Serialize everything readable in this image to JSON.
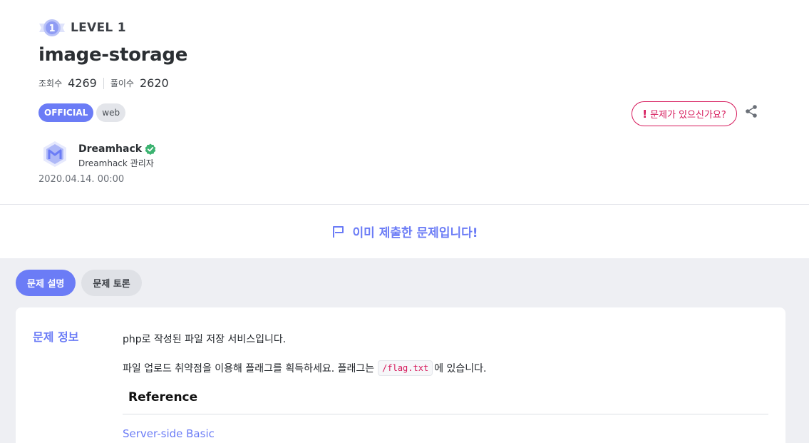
{
  "challenge": {
    "level_label": "LEVEL 1",
    "level_number": "1",
    "title": "image-storage",
    "views_label": "조회수",
    "views": "4269",
    "solves_label": "풀이수",
    "solves": "2620",
    "tags": [
      "OFFICIAL",
      "web"
    ],
    "report_button": "문제가 있으신가요?",
    "report_icon": "exclamation-icon",
    "share_icon": "share-icon"
  },
  "author": {
    "name": "Dreamhack",
    "role": "Dreamhack 관리자",
    "date": "2020.04.14. 00:00",
    "verified_icon": "verified-check-icon"
  },
  "banner": {
    "text": "이미 제출한 문제입니다!",
    "icon": "flag-icon"
  },
  "tabs": [
    {
      "label": "문제 설명",
      "active": true
    },
    {
      "label": "문제 토론",
      "active": false
    }
  ],
  "info": {
    "section_label": "문제 정보",
    "line1": "php로 작성된 파일 저장 서비스입니다.",
    "line2_before": "파일 업로드 취약점을 이용해 플래그를 획득하세요. 플래그는",
    "line2_code": "/flag.txt",
    "line2_after": "에 있습니다.",
    "reference_title": "Reference",
    "reference_link": "Server-side Basic"
  },
  "colors": {
    "accent": "#6b7cf6",
    "danger": "#d6195b",
    "verified": "#3cb371",
    "body_bg": "#eeeff3"
  }
}
